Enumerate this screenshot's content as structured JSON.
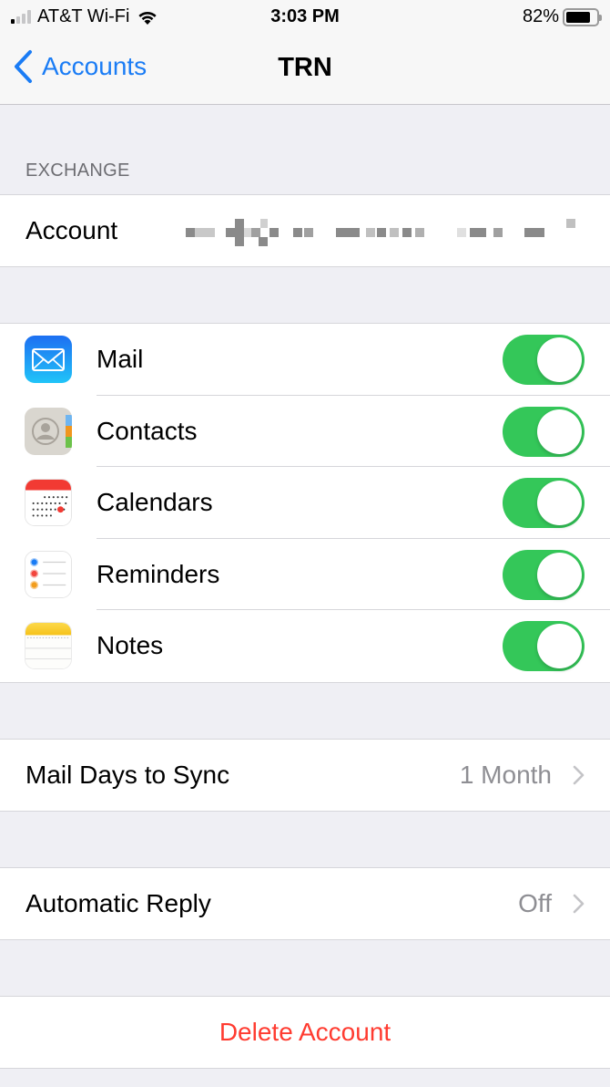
{
  "status_bar": {
    "carrier": "AT&T Wi-Fi",
    "signal_bars_on": 1,
    "signal_bars_total": 4,
    "time": "3:03 PM",
    "battery_percent": "82%",
    "battery_level": 0.82
  },
  "nav": {
    "back_label": "Accounts",
    "title": "TRN"
  },
  "exchange_section": {
    "header": "EXCHANGE",
    "account_label": "Account",
    "account_value_redacted": true
  },
  "apps": [
    {
      "name": "Mail",
      "icon": "mail-icon",
      "enabled": true
    },
    {
      "name": "Contacts",
      "icon": "contacts-icon",
      "enabled": true
    },
    {
      "name": "Calendars",
      "icon": "calendar-icon",
      "enabled": true
    },
    {
      "name": "Reminders",
      "icon": "reminders-icon",
      "enabled": true
    },
    {
      "name": "Notes",
      "icon": "notes-icon",
      "enabled": true
    }
  ],
  "mail_days": {
    "label": "Mail Days to Sync",
    "value": "1 Month"
  },
  "auto_reply": {
    "label": "Automatic Reply",
    "value": "Off"
  },
  "delete": {
    "label": "Delete Account"
  },
  "colors": {
    "accent": "#1a7cf5",
    "toggle_on": "#34c759",
    "destructive": "#ff3b30",
    "background": "#efeff4"
  }
}
